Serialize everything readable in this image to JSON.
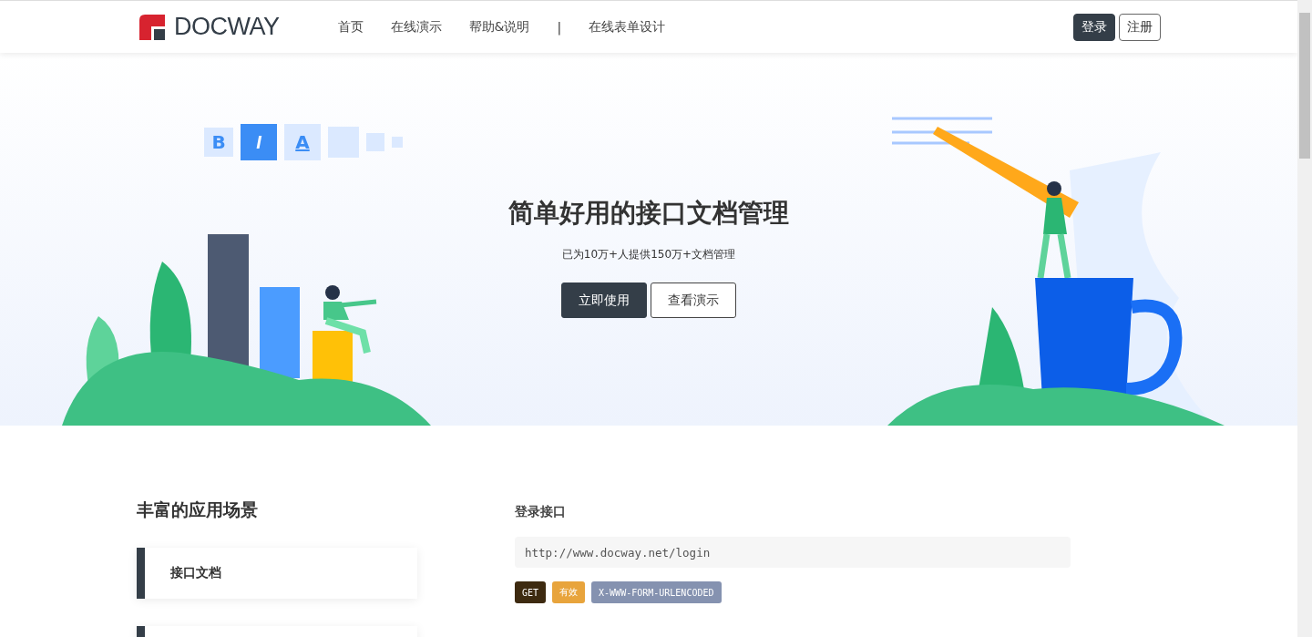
{
  "header": {
    "logo_text": "DOCWAY",
    "nav": [
      {
        "label": "首页",
        "kind": "link"
      },
      {
        "label": "在线演示",
        "kind": "link"
      },
      {
        "label": "帮助&说明",
        "kind": "link"
      },
      {
        "label": "|",
        "kind": "separator"
      },
      {
        "label": "在线表单设计",
        "kind": "link"
      }
    ],
    "login": "登录",
    "register": "注册"
  },
  "hero": {
    "format_letters": [
      "B",
      "I",
      "A"
    ],
    "title": "简单好用的接口文档管理",
    "subtitle": "已为10万+人提供150万+文档管理",
    "primary_button": "立即使用",
    "secondary_button": "查看演示"
  },
  "scenarios": {
    "title": "丰富的应用场景",
    "items": [
      {
        "label": "接口文档"
      }
    ]
  },
  "api": {
    "title": "登录接口",
    "url": "http://www.docway.net/login",
    "tags": [
      {
        "label": "GET",
        "color": "#3d2a10"
      },
      {
        "label": "有效",
        "color": "#e8a43c"
      },
      {
        "label": "X-WWW-FORM-URLENCODED",
        "color": "#8592b0"
      }
    ]
  }
}
